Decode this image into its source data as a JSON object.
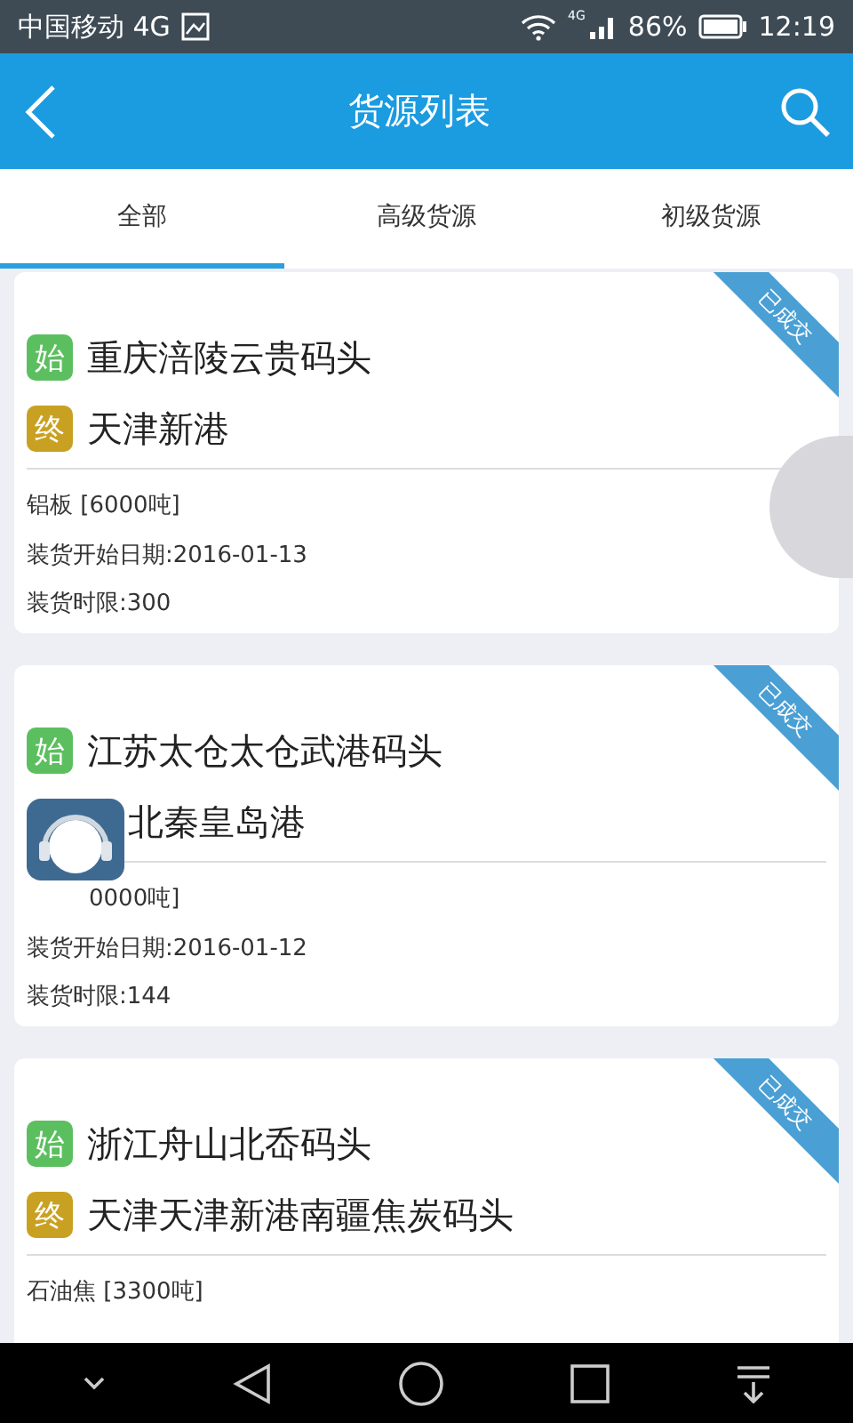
{
  "status_bar": {
    "carrier": "中国移动 4G",
    "network": "4G",
    "battery": "86%",
    "time": "12:19"
  },
  "header": {
    "title": "货源列表"
  },
  "tabs": [
    {
      "label": "全部",
      "selected": true
    },
    {
      "label": "高级货源",
      "selected": false
    },
    {
      "label": "初级货源",
      "selected": false
    }
  ],
  "cards": [
    {
      "ribbon": "已成交",
      "stops": [
        {
          "kind": "start",
          "tag": "始",
          "name": "重庆涪陵云贵码头"
        },
        {
          "kind": "end",
          "tag": "终",
          "name": "天津新港"
        }
      ],
      "details": [
        {
          "kind": "cargo",
          "text": "铝板 [6000吨]"
        },
        {
          "kind": "line",
          "text": "装货开始日期:2016-01-13"
        },
        {
          "kind": "line",
          "text": "装货时限:300"
        }
      ]
    },
    {
      "ribbon": "已成交",
      "stops": [
        {
          "kind": "start",
          "tag": "始",
          "name": "江苏太仓太仓武港码头"
        },
        {
          "kind": "end",
          "covered": true,
          "name": "北秦皇岛港"
        }
      ],
      "details": [
        {
          "kind": "cargo",
          "covered": true,
          "text": "0000吨]"
        },
        {
          "kind": "line",
          "text": "装货开始日期:2016-01-12"
        },
        {
          "kind": "line",
          "text": "装货时限:144"
        }
      ]
    },
    {
      "ribbon": "已成交",
      "stops": [
        {
          "kind": "start",
          "tag": "始",
          "name": "浙江舟山北岙码头"
        },
        {
          "kind": "end",
          "tag": "终",
          "name": "天津天津新港南疆焦炭码头"
        }
      ],
      "details": [
        {
          "kind": "cargo",
          "text": "石油焦 [3300吨]"
        }
      ]
    }
  ]
}
